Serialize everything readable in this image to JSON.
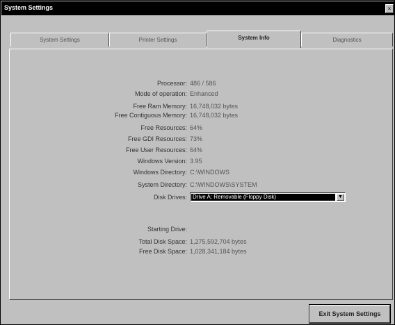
{
  "window": {
    "title": "System Settings",
    "close_glyph": "×"
  },
  "tabs": [
    {
      "label": "System Settings",
      "active": false
    },
    {
      "label": "Printer Settings",
      "active": false
    },
    {
      "label": "System Info",
      "active": true
    },
    {
      "label": "Diagnostics",
      "active": false
    }
  ],
  "info": {
    "processor": {
      "label": "Processor:",
      "value": "486 / 586"
    },
    "mode": {
      "label": "Mode of operation:",
      "value": "Enhanced"
    },
    "free_ram": {
      "label": "Free Ram Memory:",
      "value": "16,748,032 bytes"
    },
    "free_contiguous": {
      "label": "Free Contiguous Memory:",
      "value": "16,748,032 bytes"
    },
    "free_resources": {
      "label": "Free Resources:",
      "value": "64%"
    },
    "free_gdi": {
      "label": "Free GDI Resources:",
      "value": "73%"
    },
    "free_user": {
      "label": "Free User Resources:",
      "value": "64%"
    },
    "windows_version": {
      "label": "Windows Version:",
      "value": "3.95"
    },
    "windows_directory": {
      "label": "Windows Directory:",
      "value": "C:\\WINDOWS"
    },
    "system_directory": {
      "label": "System Directory:",
      "value": "C:\\WINDOWS\\SYSTEM"
    },
    "disk_drives": {
      "label": "Disk Drives:",
      "value": "Drive A: Removable (Floppy Disk)"
    },
    "starting_drive": {
      "label": "Starting Drive:",
      "value": ""
    },
    "total_disk": {
      "label": "Total Disk Space:",
      "value": "1,275,592,704 bytes"
    },
    "free_disk": {
      "label": "Free Disk Space:",
      "value": "1,028,341,184 bytes"
    }
  },
  "buttons": {
    "exit_label": "Exit System Settings"
  },
  "icons": {
    "combo_arrow": "chevron-down-icon"
  },
  "colors": {
    "face": "#c0c0c0",
    "titlebar": "#000000",
    "selection": "#000000"
  }
}
